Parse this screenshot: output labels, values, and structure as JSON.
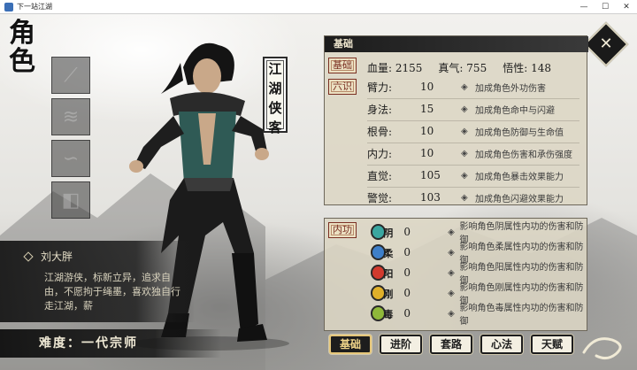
{
  "window": {
    "title": "下一站江湖",
    "minimize": "—",
    "maximize": "☐",
    "close": "✕"
  },
  "header": {
    "glyph1": "角",
    "glyph2": "色"
  },
  "equipment_slots": [
    {
      "icon": "weapon-slot-icon"
    },
    {
      "icon": "armor-slot-icon"
    },
    {
      "icon": "belt-slot-icon"
    },
    {
      "icon": "boots-slot-icon"
    }
  ],
  "character": {
    "title_chars": [
      "江",
      "湖",
      "侠",
      "客"
    ],
    "name": "刘大胖",
    "bio": "江湖游侠，标新立异，追求自由，不愿拘于绳墨，喜欢独自行走江湖，薪",
    "difficulty": "难度：一代宗师"
  },
  "basic": {
    "header": "基础",
    "tag_basic": "基础",
    "tag_six": "六识",
    "hp_label": "血量:",
    "hp": "2155",
    "qi_label": "真气:",
    "qi": "755",
    "wuxing_label": "悟性:",
    "wuxing": "148",
    "attributes": [
      {
        "label": "臂力:",
        "value": "10",
        "desc": "加成角色外功伤害"
      },
      {
        "label": "身法:",
        "value": "15",
        "desc": "加成角色命中与闪避"
      },
      {
        "label": "根骨:",
        "value": "10",
        "desc": "加成角色防御与生命值"
      },
      {
        "label": "内力:",
        "value": "10",
        "desc": "加成角色伤害和承伤强度"
      },
      {
        "label": "直觉:",
        "value": "105",
        "desc": "加成角色暴击效果能力"
      },
      {
        "label": "警觉:",
        "value": "103",
        "desc": "加成角色闪避效果能力"
      }
    ]
  },
  "inner": {
    "tag": "内功",
    "rows": [
      {
        "char": "阴",
        "value": "0",
        "desc": "影响角色阴属性内功的伤害和防御",
        "color": "#3aa6a0"
      },
      {
        "char": "柔",
        "value": "0",
        "desc": "影响角色柔属性内功的伤害和防御",
        "color": "#3e7fc9"
      },
      {
        "char": "阳",
        "value": "0",
        "desc": "影响角色阳属性内功的伤害和防御",
        "color": "#d13a2e"
      },
      {
        "char": "刚",
        "value": "0",
        "desc": "影响角色刚属性内功的伤害和防御",
        "color": "#e0b02a"
      },
      {
        "char": "毒",
        "value": "0",
        "desc": "影响角色毒属性内功的伤害和防御",
        "color": "#8fb83a"
      }
    ]
  },
  "tabs": [
    "基础",
    "进阶",
    "套路",
    "心法",
    "天赋"
  ],
  "bullet": "◈"
}
